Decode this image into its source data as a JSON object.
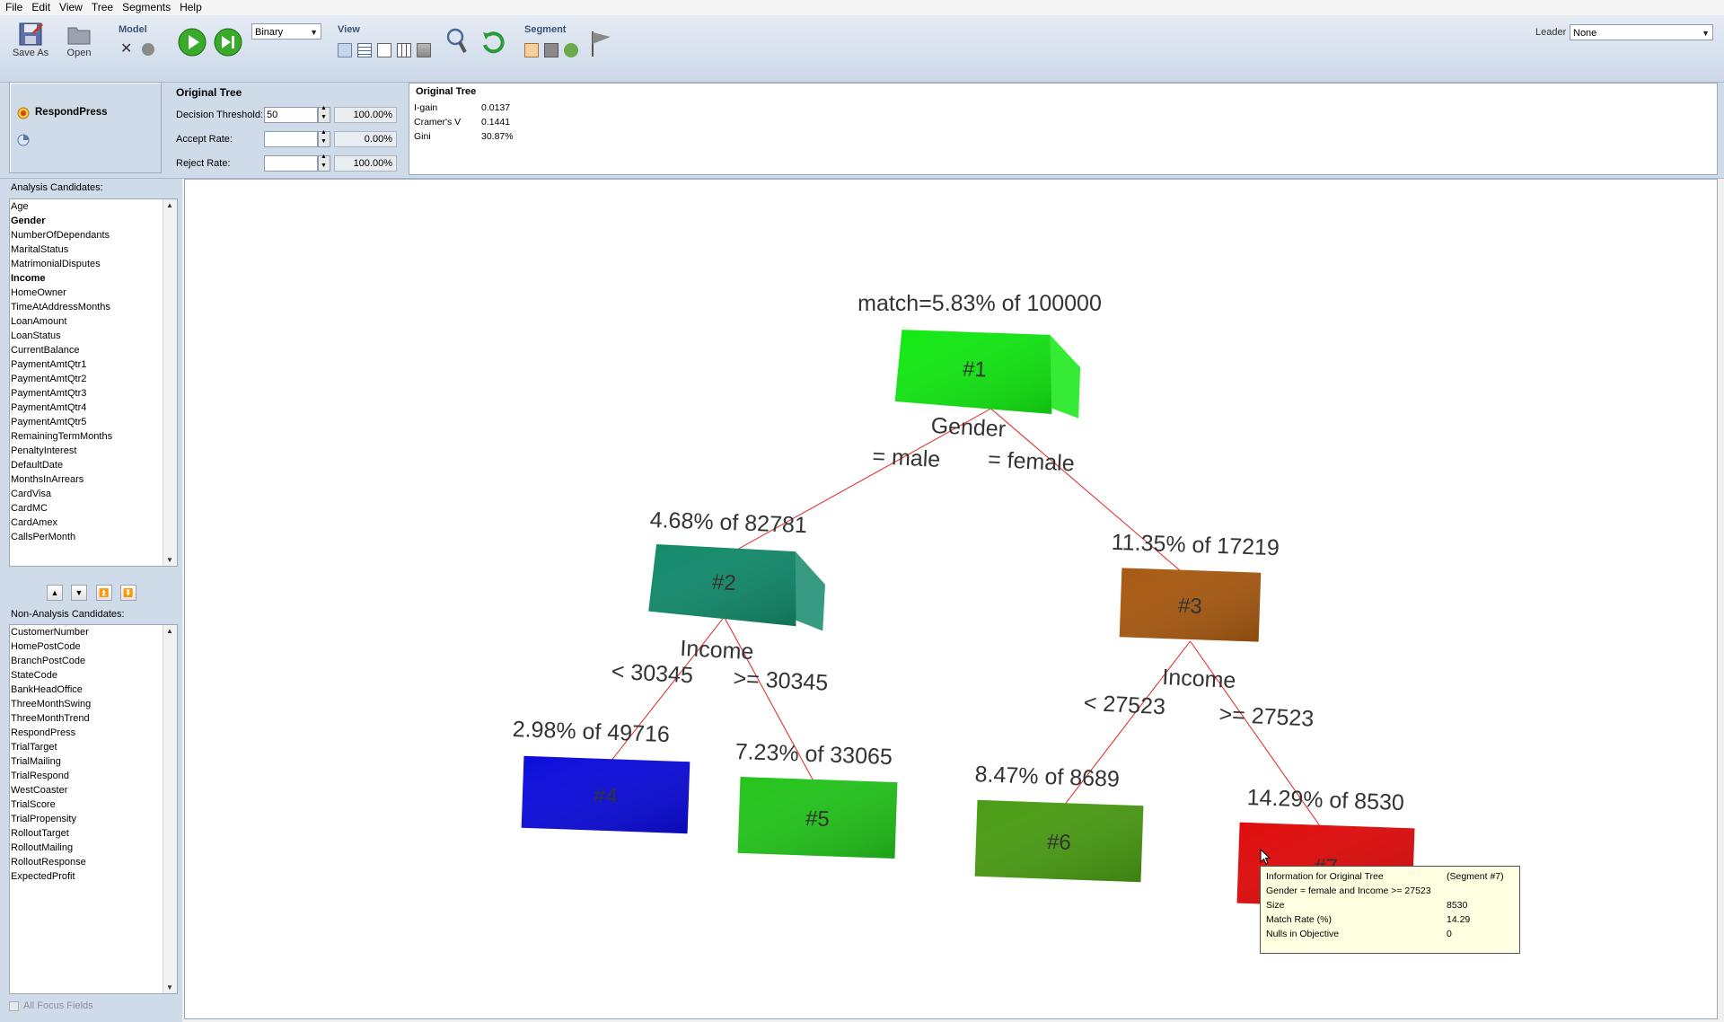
{
  "menu": [
    "File",
    "Edit",
    "View",
    "Tree",
    "Segments",
    "Help"
  ],
  "toolbar": {
    "save_as": "Save As",
    "open": "Open",
    "model_label": "Model",
    "view_label": "View",
    "segment_label": "Segment",
    "model_type": "Binary",
    "leader_label": "Leader",
    "leader_value": "None"
  },
  "objective": {
    "name": "RespondPress"
  },
  "controls": {
    "title": "Original Tree",
    "decision_threshold_label": "Decision Threshold:",
    "decision_threshold_value": "50",
    "decision_threshold_pct": "100.00%",
    "accept_rate_label": "Accept Rate:",
    "accept_rate_value": "",
    "accept_rate_pct": "0.00%",
    "reject_rate_label": "Reject Rate:",
    "reject_rate_value": "",
    "reject_rate_pct": "100.00%"
  },
  "stats": {
    "title": "Original Tree",
    "rows": [
      {
        "label": "I-gain",
        "value": "0.0137"
      },
      {
        "label": "Cramer's V",
        "value": "0.1441"
      },
      {
        "label": "Gini",
        "value": "30.87%"
      }
    ]
  },
  "analysis": {
    "label": "Analysis Candidates:",
    "items": [
      {
        "name": "Age",
        "bold": false
      },
      {
        "name": "Gender",
        "bold": true
      },
      {
        "name": "NumberOfDependants",
        "bold": false
      },
      {
        "name": "MaritalStatus",
        "bold": false
      },
      {
        "name": "MatrimonialDisputes",
        "bold": false
      },
      {
        "name": "Income",
        "bold": true
      },
      {
        "name": "HomeOwner",
        "bold": false
      },
      {
        "name": "TimeAtAddressMonths",
        "bold": false
      },
      {
        "name": "LoanAmount",
        "bold": false
      },
      {
        "name": "LoanStatus",
        "bold": false
      },
      {
        "name": "CurrentBalance",
        "bold": false
      },
      {
        "name": "PaymentAmtQtr1",
        "bold": false
      },
      {
        "name": "PaymentAmtQtr2",
        "bold": false
      },
      {
        "name": "PaymentAmtQtr3",
        "bold": false
      },
      {
        "name": "PaymentAmtQtr4",
        "bold": false
      },
      {
        "name": "PaymentAmtQtr5",
        "bold": false
      },
      {
        "name": "RemainingTermMonths",
        "bold": false
      },
      {
        "name": "PenaltyInterest",
        "bold": false
      },
      {
        "name": "DefaultDate",
        "bold": false
      },
      {
        "name": "MonthsInArrears",
        "bold": false
      },
      {
        "name": "CardVisa",
        "bold": false
      },
      {
        "name": "CardMC",
        "bold": false
      },
      {
        "name": "CardAmex",
        "bold": false
      },
      {
        "name": "CallsPerMonth",
        "bold": false
      }
    ]
  },
  "non_analysis": {
    "label": "Non-Analysis Candidates:",
    "items": [
      "CustomerNumber",
      "HomePostCode",
      "BranchPostCode",
      "StateCode",
      "BankHeadOffice",
      "ThreeMonthSwing",
      "ThreeMonthTrend",
      "RespondPress",
      "TrialTarget",
      "TrialMailing",
      "TrialRespond",
      "WestCoaster",
      "TrialScore",
      "TrialPropensity",
      "RolloutTarget",
      "RolloutMailing",
      "RolloutResponse",
      "ExpectedProfit"
    ]
  },
  "all_focus_fields": "All Focus Fields",
  "tree": {
    "nodes": [
      {
        "id": "#1",
        "label": "match=5.83% of 100000",
        "color": "#13e813"
      },
      {
        "id": "#2",
        "label": "4.68% of 82781",
        "color": "#138a6a"
      },
      {
        "id": "#3",
        "label": "11.35% of 17219",
        "color": "#a85a12"
      },
      {
        "id": "#4",
        "label": "2.98% of 49716",
        "color": "#0c0cdc"
      },
      {
        "id": "#5",
        "label": "7.23% of 33065",
        "color": "#24c41c"
      },
      {
        "id": "#6",
        "label": "8.47% of 8689",
        "color": "#4a9c14"
      },
      {
        "id": "#7",
        "label": "14.29% of 8530",
        "color": "#e00c0c"
      }
    ],
    "splits": [
      {
        "var": "Gender",
        "left": "= male",
        "right": "= female"
      },
      {
        "var": "Income",
        "left": "< 30345",
        "right": ">= 30345"
      },
      {
        "var": "Income",
        "left": "< 27523",
        "right": ">= 27523"
      }
    ]
  },
  "tooltip": {
    "title": "Information for Original Tree",
    "segment": "(Segment #7)",
    "rule": "Gender = female and Income >= 27523",
    "rows": [
      {
        "label": "Size",
        "value": "8530"
      },
      {
        "label": "Match Rate (%)",
        "value": "14.29"
      },
      {
        "label": "Nulls in Objective",
        "value": "0"
      }
    ]
  }
}
